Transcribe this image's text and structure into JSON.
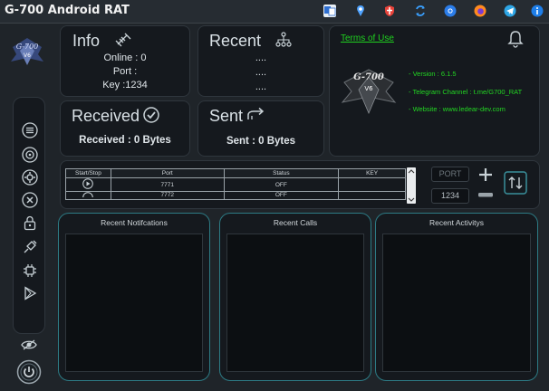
{
  "window": {
    "title": "G-700 Android RAT"
  },
  "toolbar": {
    "icons": [
      "translate-icon",
      "map-pin-icon",
      "shield-icon",
      "refresh-icon",
      "chrome-icon",
      "firefox-icon",
      "telegram-icon",
      "info-icon"
    ]
  },
  "info": {
    "title": "Info",
    "online": "Online : 0",
    "port": "Port :",
    "key": "Key :1234"
  },
  "recent": {
    "title": "Recent",
    "lines": [
      "....",
      "....",
      "...."
    ]
  },
  "received": {
    "title": "Received",
    "value": "Received : 0 Bytes"
  },
  "sent": {
    "title": "Sent",
    "value": "Sent : 0 Bytes"
  },
  "about": {
    "terms": "Terms of Use",
    "version": "- Version : 6.1.5",
    "telegram": "- Telegram Channel : t.me/G700_RAT",
    "website": "- Website : www.ledear-dev.com"
  },
  "ports_table": {
    "headers": [
      "Start/Stop",
      "Port",
      "Status",
      "KEY"
    ],
    "rows": [
      {
        "port": "7771",
        "status": "OFF",
        "key": ""
      },
      {
        "port": "7772",
        "status": "OFF",
        "key": ""
      }
    ]
  },
  "port_controls": {
    "port_label": "PORT",
    "key_value": "1234"
  },
  "panels": {
    "notifications": "Recent Notifcations",
    "calls": "Recent Calls",
    "activity": "Recent Activitys"
  }
}
